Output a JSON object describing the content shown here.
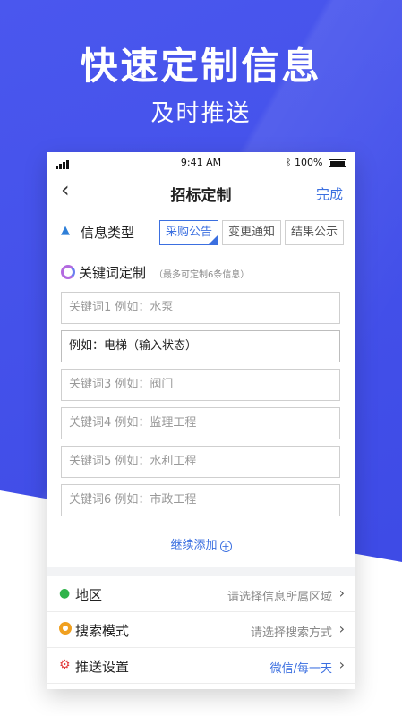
{
  "hero": {
    "headline": "快速定制信息",
    "subline": "及时推送"
  },
  "status_bar": {
    "time": "9:41 AM",
    "battery": "100%"
  },
  "nav": {
    "title": "招标定制",
    "done_label": "完成"
  },
  "info_type": {
    "label": "信息类型",
    "options": [
      "采购公告",
      "变更通知",
      "结果公示"
    ],
    "selected": "采购公告"
  },
  "keywords": {
    "title": "关键词定制",
    "note": "（最多可定制6条信息）",
    "items": [
      "关键词1  例如：水泵",
      "例如：电梯（输入状态）",
      "关键词3  例如：阀门",
      "关键词4  例如：监理工程",
      "关键词5  例如：水利工程",
      "关键词6  例如：市政工程"
    ],
    "add_more": "继续添加"
  },
  "settings": [
    {
      "label": "地区",
      "value": "请选择信息所属区域",
      "icon": "location-pin-icon"
    },
    {
      "label": "搜索模式",
      "value": "请选择搜索方式",
      "icon": "ring-icon"
    },
    {
      "label": "推送设置",
      "value": "微信/每一天",
      "icon": "gear-icon"
    }
  ],
  "colors": {
    "brand_blue": "#3b48e4",
    "accent": "#3b6fe0"
  }
}
